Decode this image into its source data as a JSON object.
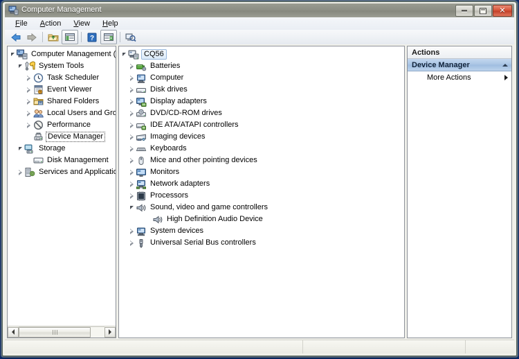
{
  "window": {
    "title": "Computer Management",
    "title_icon": "computer-management-icon",
    "buttons": {
      "minimize": "minimize-button",
      "maximize": "maximize-button",
      "close": "close-button",
      "close_glyph": "✕"
    }
  },
  "menubar": {
    "items": [
      {
        "label": "File",
        "accel": "F"
      },
      {
        "label": "Action",
        "accel": "A"
      },
      {
        "label": "View",
        "accel": "V"
      },
      {
        "label": "Help",
        "accel": "H"
      }
    ]
  },
  "toolbar": {
    "items": [
      {
        "name": "back-button",
        "icon": "left-arrow-icon"
      },
      {
        "name": "forward-button",
        "icon": "right-arrow-icon"
      },
      {
        "name": "up-folder-button",
        "icon": "folder-up-icon"
      },
      {
        "name": "show-console-tree-button",
        "icon": "console-tree-icon"
      },
      {
        "name": "help-button",
        "icon": "question-mark-icon"
      },
      {
        "name": "show-action-pane-button",
        "icon": "action-pane-icon"
      },
      {
        "name": "scan-hardware-button",
        "icon": "scan-hardware-icon"
      }
    ]
  },
  "console_tree": {
    "items": [
      {
        "label": "Computer Management (Local",
        "icon": "computer-management-icon",
        "indent": 0,
        "state": "expanded",
        "selected": false
      },
      {
        "label": "System Tools",
        "icon": "system-tools-icon",
        "indent": 1,
        "state": "expanded",
        "selected": false
      },
      {
        "label": "Task Scheduler",
        "icon": "clock-icon",
        "indent": 2,
        "state": "collapsed",
        "selected": false
      },
      {
        "label": "Event Viewer",
        "icon": "event-viewer-icon",
        "indent": 2,
        "state": "collapsed",
        "selected": false
      },
      {
        "label": "Shared Folders",
        "icon": "shared-folders-icon",
        "indent": 2,
        "state": "collapsed",
        "selected": false
      },
      {
        "label": "Local Users and Groups",
        "icon": "users-icon",
        "indent": 2,
        "state": "collapsed",
        "selected": false
      },
      {
        "label": "Performance",
        "icon": "performance-icon",
        "indent": 2,
        "state": "collapsed",
        "selected": false
      },
      {
        "label": "Device Manager",
        "icon": "device-manager-icon",
        "indent": 2,
        "state": "leaf",
        "selected": true
      },
      {
        "label": "Storage",
        "icon": "storage-icon",
        "indent": 1,
        "state": "expanded",
        "selected": false
      },
      {
        "label": "Disk Management",
        "icon": "disk-management-icon",
        "indent": 2,
        "state": "leaf",
        "selected": false
      },
      {
        "label": "Services and Applications",
        "icon": "services-icon",
        "indent": 1,
        "state": "collapsed",
        "selected": false
      }
    ]
  },
  "device_tree": {
    "root": {
      "label": "CQ56",
      "icon": "computer-icon",
      "state": "expanded",
      "selected": true
    },
    "items": [
      {
        "label": "Batteries",
        "icon": "battery-icon",
        "indent": 1,
        "state": "collapsed"
      },
      {
        "label": "Computer",
        "icon": "computer-device-icon",
        "indent": 1,
        "state": "collapsed"
      },
      {
        "label": "Disk drives",
        "icon": "disk-drive-icon",
        "indent": 1,
        "state": "collapsed"
      },
      {
        "label": "Display adapters",
        "icon": "display-adapter-icon",
        "indent": 1,
        "state": "collapsed"
      },
      {
        "label": "DVD/CD-ROM drives",
        "icon": "dvd-drive-icon",
        "indent": 1,
        "state": "collapsed"
      },
      {
        "label": "IDE ATA/ATAPI controllers",
        "icon": "ide-controller-icon",
        "indent": 1,
        "state": "collapsed"
      },
      {
        "label": "Imaging devices",
        "icon": "imaging-device-icon",
        "indent": 1,
        "state": "collapsed"
      },
      {
        "label": "Keyboards",
        "icon": "keyboard-icon",
        "indent": 1,
        "state": "collapsed"
      },
      {
        "label": "Mice and other pointing devices",
        "icon": "mouse-icon",
        "indent": 1,
        "state": "collapsed"
      },
      {
        "label": "Monitors",
        "icon": "monitor-icon",
        "indent": 1,
        "state": "collapsed"
      },
      {
        "label": "Network adapters",
        "icon": "network-adapter-icon",
        "indent": 1,
        "state": "collapsed"
      },
      {
        "label": "Processors",
        "icon": "processor-icon",
        "indent": 1,
        "state": "collapsed"
      },
      {
        "label": "Sound, video and game controllers",
        "icon": "speaker-icon",
        "indent": 1,
        "state": "expanded"
      },
      {
        "label": "High Definition Audio Device",
        "icon": "speaker-icon",
        "indent": 2,
        "state": "leaf"
      },
      {
        "label": "System devices",
        "icon": "system-device-icon",
        "indent": 1,
        "state": "collapsed"
      },
      {
        "label": "Universal Serial Bus controllers",
        "icon": "usb-icon",
        "indent": 1,
        "state": "collapsed"
      }
    ]
  },
  "actions": {
    "header": "Actions",
    "group": {
      "label": "Device Manager",
      "collapse_icon": "chevron-up-icon"
    },
    "items": [
      {
        "label": "More Actions",
        "submenu_icon": "chevron-right-icon"
      }
    ]
  },
  "scrollbar": {
    "left": "scroll-left-arrow",
    "right": "scroll-right-arrow",
    "thumb": "scroll-thumb"
  },
  "statusbar": {
    "text": ""
  },
  "colors": {
    "titlebar": "#8d8f85",
    "accent_blue": "#a9c4e4",
    "close_red": "#d6553a",
    "pane_border": "#8d9199"
  }
}
